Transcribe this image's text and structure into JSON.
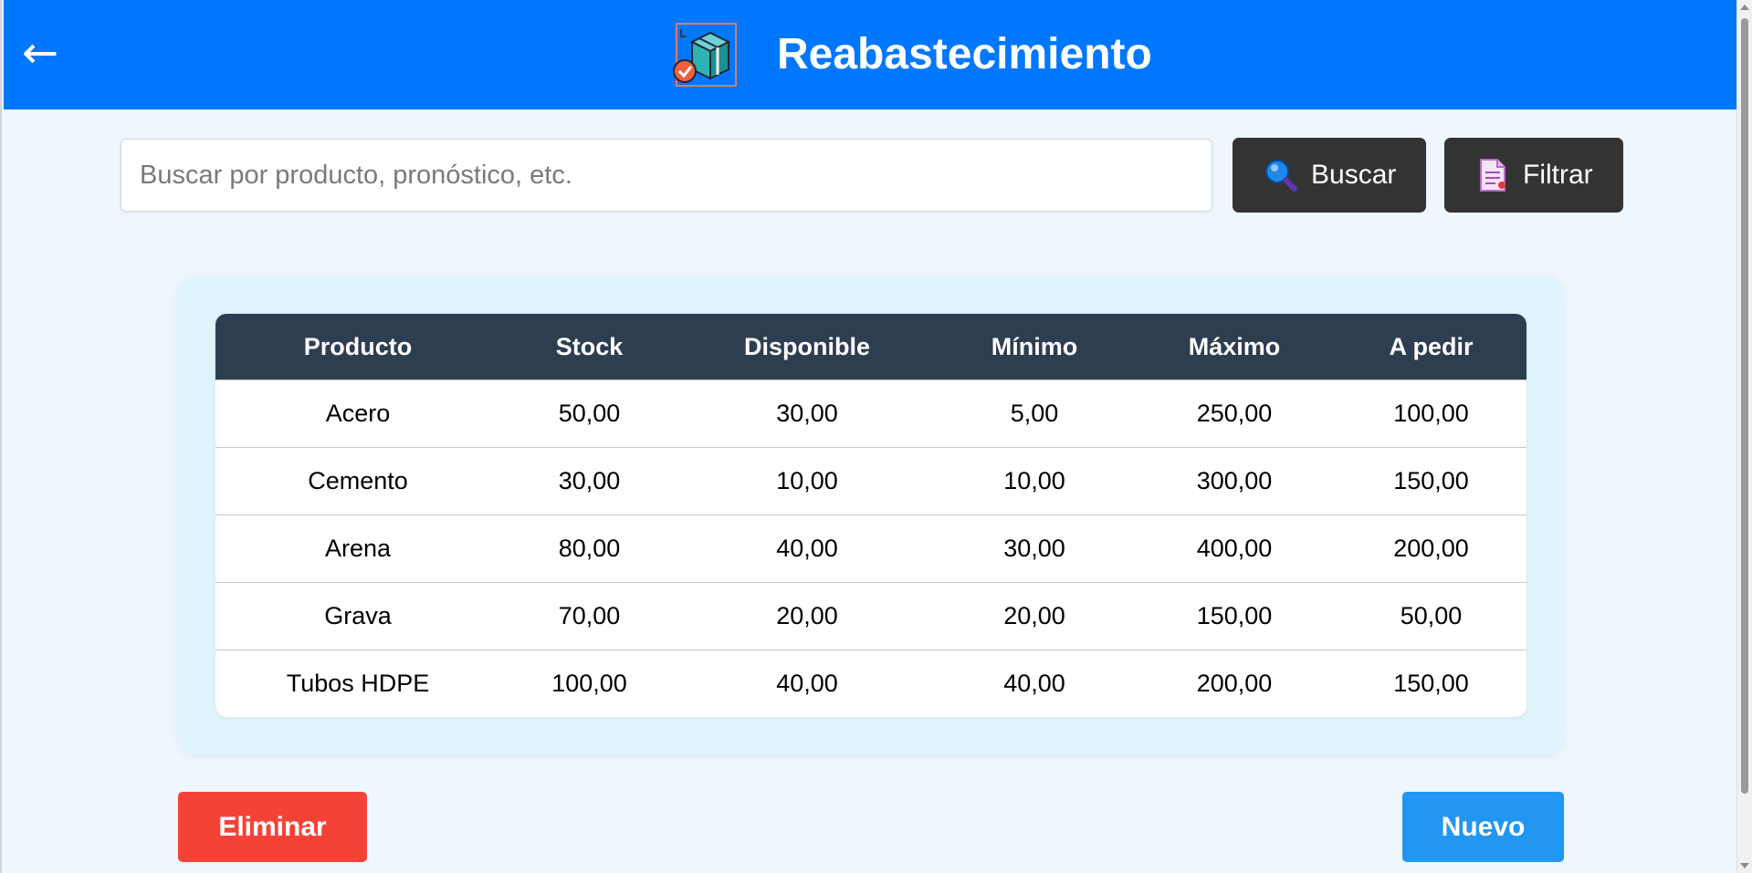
{
  "header": {
    "back_icon": "←",
    "logo_icon": "box-check-icon",
    "title": "Reabastecimiento",
    "color": "#0077ff"
  },
  "search": {
    "placeholder": "Buscar por producto, pronóstico, etc.",
    "value": "",
    "search_label": "Buscar",
    "search_icon": "magnifier-icon",
    "filter_label": "Filtrar",
    "filter_icon": "document-icon"
  },
  "table": {
    "columns": [
      "Producto",
      "Stock",
      "Disponible",
      "Mínimo",
      "Máximo",
      "A pedir"
    ],
    "rows": [
      [
        "Acero",
        "50,00",
        "30,00",
        "5,00",
        "250,00",
        "100,00"
      ],
      [
        "Cemento",
        "30,00",
        "10,00",
        "10,00",
        "300,00",
        "150,00"
      ],
      [
        "Arena",
        "80,00",
        "40,00",
        "30,00",
        "400,00",
        "200,00"
      ],
      [
        "Grava",
        "70,00",
        "20,00",
        "20,00",
        "150,00",
        "50,00"
      ],
      [
        "Tubos HDPE",
        "100,00",
        "40,00",
        "40,00",
        "200,00",
        "150,00"
      ]
    ]
  },
  "actions": {
    "delete_label": "Eliminar",
    "new_label": "Nuevo",
    "delete_color": "#f44336",
    "new_color": "#2196f3"
  }
}
